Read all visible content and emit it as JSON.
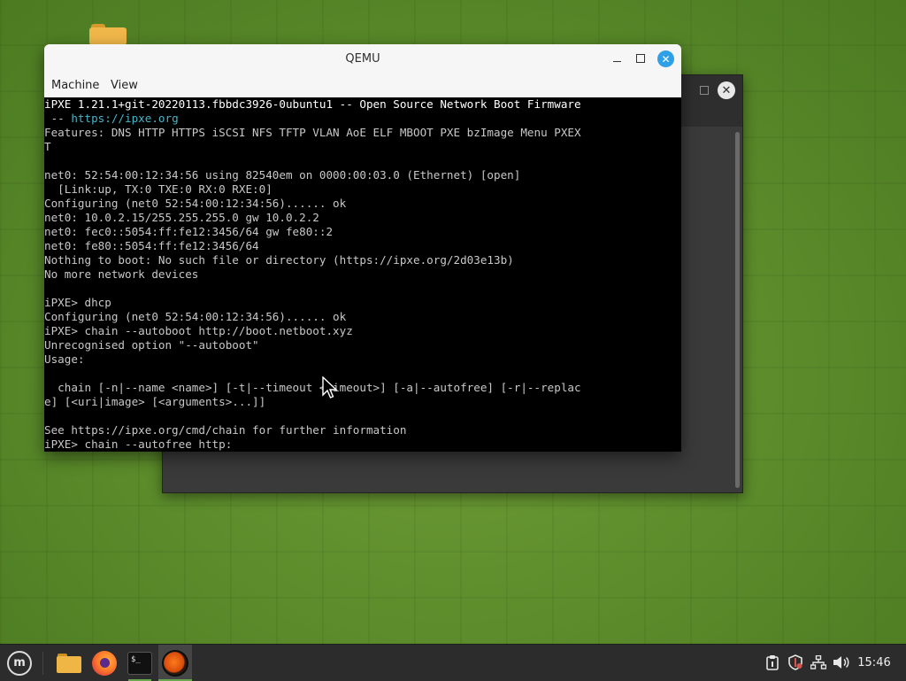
{
  "window": {
    "title": "QEMU",
    "menu": [
      "Machine",
      "View"
    ]
  },
  "terminal": {
    "lines": [
      {
        "text": "iPXE 1.21.1+git-20220113.fbbdc3926-0ubuntu1 -- Open Source Network Boot Firmware",
        "style": "hl"
      },
      {
        "text": " -- ",
        "url": "https://ipxe.org"
      },
      {
        "text": "Features: DNS HTTP HTTPS iSCSI NFS TFTP VLAN AoE ELF MBOOT PXE bzImage Menu PXEX"
      },
      {
        "text": "T"
      },
      {
        "text": ""
      },
      {
        "text": "net0: 52:54:00:12:34:56 using 82540em on 0000:00:03.0 (Ethernet) [open]"
      },
      {
        "text": "  [Link:up, TX:0 TXE:0 RX:0 RXE:0]"
      },
      {
        "text": "Configuring (net0 52:54:00:12:34:56)...... ok"
      },
      {
        "text": "net0: 10.0.2.15/255.255.255.0 gw 10.0.2.2"
      },
      {
        "text": "net0: fec0::5054:ff:fe12:3456/64 gw fe80::2"
      },
      {
        "text": "net0: fe80::5054:ff:fe12:3456/64"
      },
      {
        "text": "Nothing to boot: No such file or directory (https://ipxe.org/2d03e13b)"
      },
      {
        "text": "No more network devices"
      },
      {
        "text": ""
      },
      {
        "text": "iPXE> dhcp"
      },
      {
        "text": "Configuring (net0 52:54:00:12:34:56)...... ok"
      },
      {
        "text": "iPXE> chain --autoboot http://boot.netboot.xyz"
      },
      {
        "text": "Unrecognised option \"--autoboot\""
      },
      {
        "text": "Usage:"
      },
      {
        "text": ""
      },
      {
        "text": "  chain [-n|--name <name>] [-t|--timeout <timeout>] [-a|--autofree] [-r|--replac"
      },
      {
        "text": "e] [<uri|image> [<arguments>...]]"
      },
      {
        "text": ""
      },
      {
        "text": "See https://ipxe.org/cmd/chain for further information"
      },
      {
        "text": "iPXE> chain --autofree http:"
      }
    ]
  },
  "taskbar": {
    "apps": [
      "menu-icon",
      "folder-icon",
      "firefox-icon",
      "terminal-icon",
      "qemu-icon"
    ],
    "terminal_glyph": "$_",
    "clock": "15:46"
  },
  "colors": {
    "accent": "#2f9fe6",
    "terminal_bg": "#000000",
    "terminal_fg": "#c8c8c8",
    "url": "#45b5c8",
    "taskbar": "#2c2c2c"
  }
}
